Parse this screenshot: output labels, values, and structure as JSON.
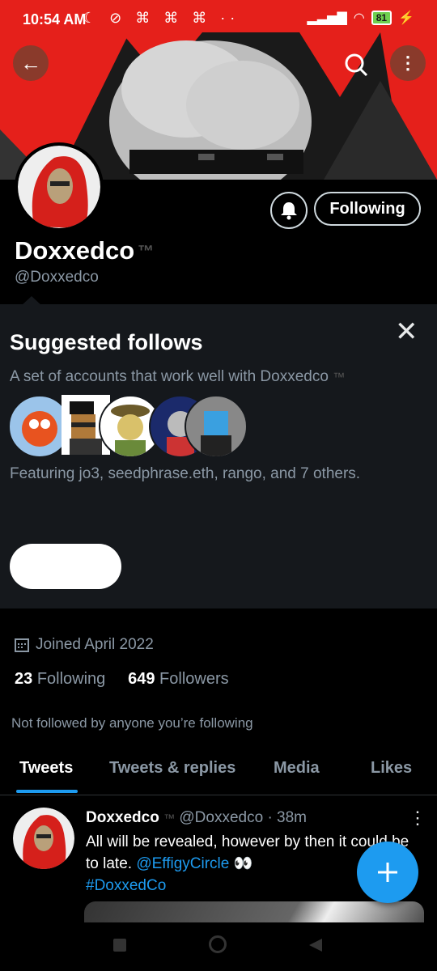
{
  "status_bar": {
    "time": "10:54 AM",
    "battery": "81"
  },
  "profile": {
    "display_name": "Doxxedco",
    "handle": "@Doxxedco",
    "following_button": "Following",
    "joined": "Joined April 2022",
    "following_count": "23",
    "following_label": "Following",
    "followers_count": "649",
    "followers_label": "Followers",
    "not_followed_text": "Not followed by anyone you’re following"
  },
  "suggested": {
    "title": "Suggested follows",
    "subtitle": "A set of accounts that work well with Doxxedco",
    "featuring": "Featuring jo3, seedphrase.eth, rango, and 7 others."
  },
  "tabs": [
    "Tweets",
    "Tweets & replies",
    "Media",
    "Likes"
  ],
  "tweet": {
    "author": "Doxxedco",
    "handle": "@Doxxedco",
    "time": "· 38m",
    "text": "All will be revealed, however by then it could be to late.",
    "mention": "@EffigyCircle",
    "emoji": "👀",
    "hashtag": "#DoxxedCo"
  },
  "colors": {
    "accent": "#1d9bf0",
    "banner_red": "#e5201b",
    "panel_bg": "#15181c"
  }
}
